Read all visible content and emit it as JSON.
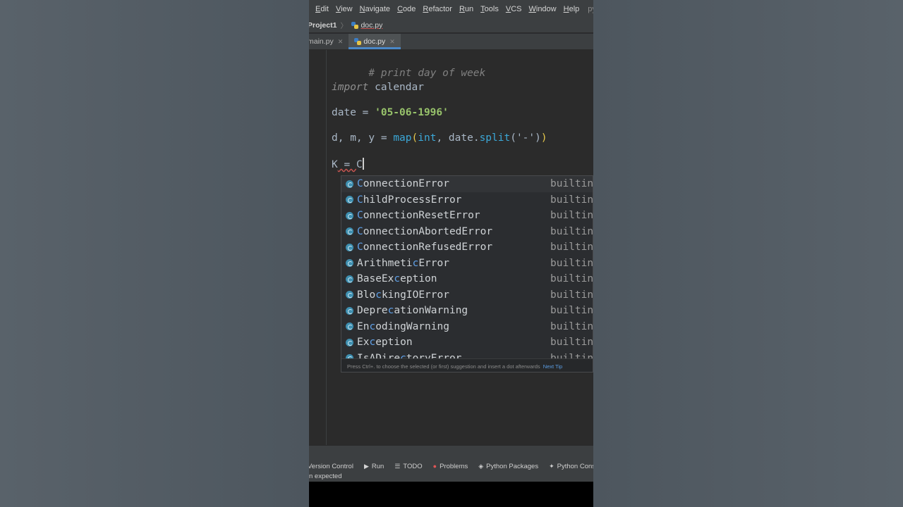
{
  "menu": {
    "items": [
      "Edit",
      "View",
      "Navigate",
      "Code",
      "Refactor",
      "Run",
      "Tools",
      "VCS",
      "Window",
      "Help"
    ],
    "project_label": "pytho"
  },
  "breadcrumb": {
    "project": "Project1",
    "file": "doc.py"
  },
  "tabs": [
    {
      "label": "main.py",
      "active": false
    },
    {
      "label": "doc.py",
      "active": true
    }
  ],
  "code": {
    "comment": "# print day of week",
    "import_kw": "import",
    "module": "calendar",
    "line3_var": "date = ",
    "line3_str": "'05-06-1996'",
    "line4_lhs": "d, m, y = ",
    "line4_map": "map",
    "line4_open": "(",
    "line4_int": "int",
    "line4_mid": ", date.",
    "line4_split": "split",
    "line4_arg": "('-')",
    "line4_close": ")",
    "line5_var": "K",
    "line5_eq": " = ",
    "line5_typed": "C"
  },
  "completion": {
    "items": [
      {
        "pre": "",
        "hl": "C",
        "post": "onnectionError",
        "location": "builtin"
      },
      {
        "pre": "",
        "hl": "C",
        "post": "hildProcessError",
        "location": "builtin"
      },
      {
        "pre": "",
        "hl": "C",
        "post": "onnectionResetError",
        "location": "builtin"
      },
      {
        "pre": "",
        "hl": "C",
        "post": "onnectionAbortedError",
        "location": "builtin"
      },
      {
        "pre": "",
        "hl": "C",
        "post": "onnectionRefusedError",
        "location": "builtin"
      },
      {
        "pre": "Arithmeti",
        "hl": "c",
        "post": "Error",
        "location": "builtin"
      },
      {
        "pre": "BaseEx",
        "hl": "c",
        "post": "eption",
        "location": "builtin"
      },
      {
        "pre": "Blo",
        "hl": "c",
        "post": "kingIOError",
        "location": "builtin"
      },
      {
        "pre": "Depre",
        "hl": "c",
        "post": "ationWarning",
        "location": "builtin"
      },
      {
        "pre": "En",
        "hl": "c",
        "post": "odingWarning",
        "location": "builtin"
      },
      {
        "pre": "Ex",
        "hl": "c",
        "post": "eption",
        "location": "builtin"
      },
      {
        "pre": "IsADire",
        "hl": "c",
        "post": "toryError",
        "location": "builtin"
      }
    ],
    "footer_hint": "Press Ctrl+. to choose the selected (or first) suggestion and insert a dot afterwards",
    "footer_link": "Next Tip"
  },
  "toolwindows": [
    {
      "label": "Version Control",
      "icon": ""
    },
    {
      "label": "Run",
      "icon": "▶"
    },
    {
      "label": "TODO",
      "icon": "☰"
    },
    {
      "label": "Problems",
      "icon": "●"
    },
    {
      "label": "Python Packages",
      "icon": "◈"
    },
    {
      "label": "Python Console",
      "icon": "✦"
    }
  ],
  "status_text": "n expected"
}
